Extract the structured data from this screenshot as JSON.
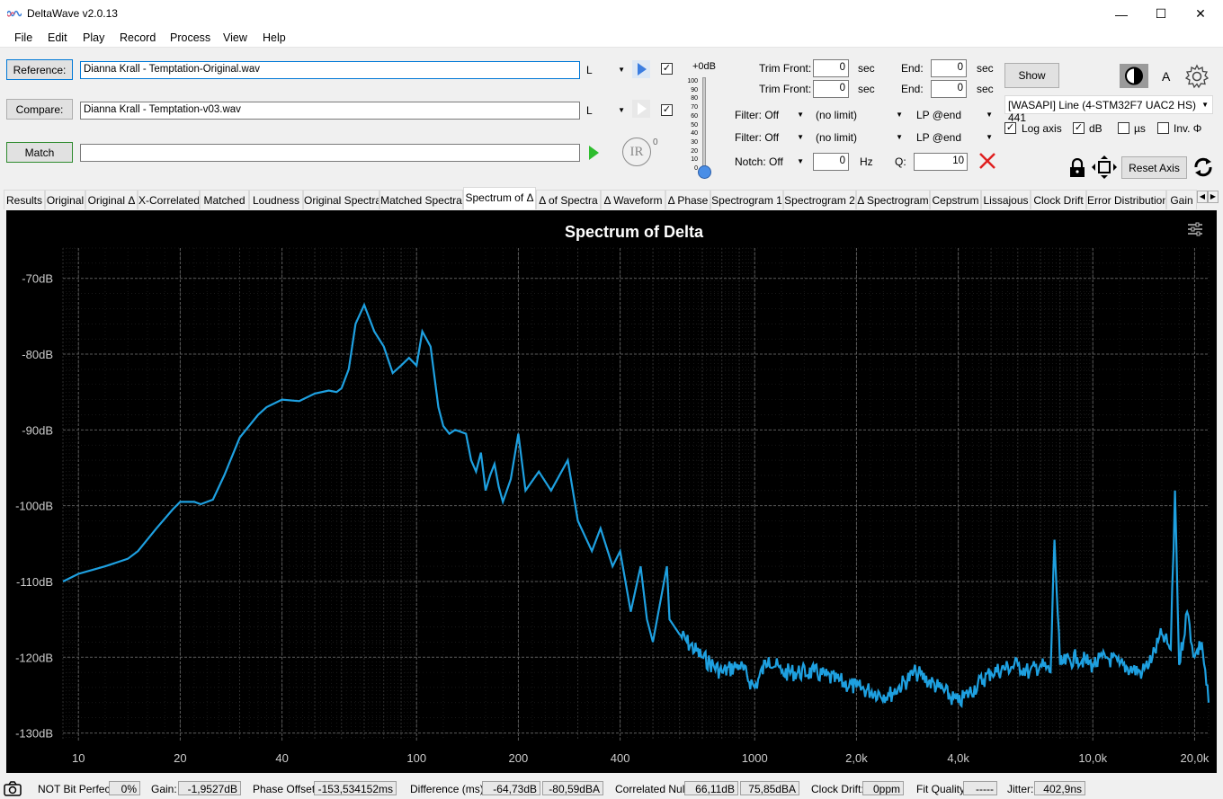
{
  "window": {
    "title": "DeltaWave v2.0.13",
    "minimize": "—",
    "maximize": "☐",
    "close": "✕"
  },
  "menu": [
    "File",
    "Edit",
    "Play",
    "Record",
    "Process",
    "View",
    "Help"
  ],
  "files": {
    "reference_label": "Reference:",
    "reference_file": "Dianna Krall - Temptation-Original.wav",
    "reference_channel": "L",
    "compare_label": "Compare:",
    "compare_file": "Dianna Krall - Temptation-v03.wav",
    "compare_channel": "L",
    "match_label": "Match",
    "match_value": ""
  },
  "ir": {
    "label": "IR",
    "superscript": "0"
  },
  "volume": {
    "label": "+0dB",
    "ticks": [
      "100",
      "90",
      "80",
      "70",
      "60",
      "50",
      "40",
      "30",
      "20",
      "10",
      "0"
    ],
    "level": 0
  },
  "trim": {
    "front_label": "Trim Front:",
    "front1": "0",
    "front2": "0",
    "unit": "sec",
    "end_label": "End:",
    "end1": "0",
    "end2": "0"
  },
  "filters": {
    "filter1": "Filter: Off",
    "filter2": "Filter: Off",
    "limit1": "(no limit)",
    "limit2": "(no limit)",
    "lp1": "LP @end",
    "lp2": "LP @end",
    "notch": "Notch: Off",
    "notch_value": "0",
    "hz": "Hz",
    "q_label": "Q:",
    "q_value": "10"
  },
  "right_panel": {
    "show_label": "Show",
    "a_label": "A",
    "device": "[WASAPI] Line (4-STM32F7 UAC2 HS) 441",
    "log_axis_label": "Log axis",
    "log_axis": true,
    "db_label": "dB",
    "db": true,
    "us_label": "µs",
    "us": false,
    "inv_label": "Inv. Φ",
    "inv": false,
    "reset_axis_label": "Reset Axis"
  },
  "tabs": [
    "Results",
    "Original",
    "Original Δ",
    "X-Correlated",
    "Matched",
    "Loudness",
    "Original Spectra",
    "Matched Spectra",
    "Spectrum of Δ",
    "Δ of Spectra",
    "Δ Waveform",
    "Δ Phase",
    "Spectrogram 1",
    "Spectrogram 2",
    "Δ Spectrogram",
    "Cepstrum",
    "Lissajous",
    "Clock Drift",
    "Error Distribution",
    "Gain"
  ],
  "active_tab": "Spectrum of Δ",
  "chart_data": {
    "type": "line",
    "title": "Spectrum of Delta",
    "xscale": "log",
    "xlim": [
      9,
      22000
    ],
    "ylim": [
      -131,
      -66
    ],
    "xticks": [
      10,
      20,
      40,
      100,
      200,
      400,
      1000,
      2000,
      4000,
      10000,
      20000
    ],
    "xtick_labels": [
      "10",
      "20",
      "40",
      "100",
      "200",
      "400",
      "1000",
      "2,0k",
      "4,0k",
      "10,0k",
      "20,0k"
    ],
    "yticks": [
      -70,
      -80,
      -90,
      -100,
      -110,
      -120,
      -130
    ],
    "ytick_labels": [
      "-70dB",
      "-80dB",
      "-90dB",
      "-100dB",
      "-110dB",
      "-120dB",
      "-130dB"
    ],
    "grid": true,
    "line_color": "#1ea0e0",
    "series": [
      {
        "x": [
          9,
          10,
          12,
          14,
          15,
          17,
          19,
          20,
          22,
          23,
          25,
          27,
          30,
          34,
          36,
          40,
          45,
          50,
          55,
          58,
          60,
          63,
          66,
          70,
          75,
          80,
          85,
          90,
          95,
          100,
          104,
          110,
          116,
          120,
          125,
          130,
          140,
          145,
          150,
          155,
          160,
          165,
          170,
          175,
          180,
          190,
          200,
          210,
          230,
          250,
          280,
          300,
          330,
          350,
          380,
          400,
          430,
          460,
          480,
          500,
          550,
          560,
          600,
          700,
          800,
          900,
          1000,
          1100,
          1200,
          1500,
          2000,
          2500,
          3000,
          3500,
          4000,
          5000,
          6000,
          6500,
          7000,
          7500,
          7700,
          8000,
          9000,
          10000,
          11000,
          12000,
          14000,
          15000,
          16000,
          17000,
          17500,
          18000,
          19000,
          20000,
          21000,
          22000
        ],
        "y": [
          -110,
          -109,
          -108,
          -107,
          -106,
          -103,
          -100.5,
          -99.5,
          -99.5,
          -99.8,
          -99.2,
          -96,
          -91,
          -88,
          -87,
          -86,
          -86.2,
          -85.2,
          -84.8,
          -85,
          -84.5,
          -82,
          -76,
          -73.5,
          -77,
          -79,
          -82.5,
          -81.5,
          -80.5,
          -81.5,
          -77,
          -79,
          -87,
          -89.5,
          -90.5,
          -90,
          -90.5,
          -94,
          -95.5,
          -93,
          -98,
          -96,
          -94.5,
          -97.5,
          -99.5,
          -96.5,
          -90.5,
          -98,
          -95.5,
          -98,
          -94,
          -102,
          -106,
          -103,
          -108,
          -106,
          -114,
          -108,
          -115,
          -118,
          -108,
          -115,
          -117,
          -120,
          -122,
          -121,
          -124,
          -120,
          -122,
          -122,
          -124,
          -125,
          -122,
          -124,
          -126,
          -122,
          -121,
          -122,
          -121,
          -122,
          -104.5,
          -121,
          -120,
          -121,
          -120,
          -121,
          -122,
          -120,
          -117,
          -119,
          -98,
          -121,
          -114,
          -120,
          -118,
          -126
        ],
        "color": "#1ea0e0"
      }
    ]
  },
  "status": {
    "bit_perfect": "NOT Bit Perfect",
    "bit_perfect_pct": "0%",
    "gain_label": "Gain:",
    "gain": "-1,9527dB",
    "phase_label": "Phase Offset:",
    "phase": "-153,534152ms",
    "diff_label": "Difference (ms):",
    "diff1": "-64,73dB",
    "diff2": "-80,59dBA",
    "null_label": "Correlated Null:",
    "null1": "66,11dB",
    "null2": "75,85dBA",
    "drift_label": "Clock Drift:",
    "drift": "0ppm",
    "fit_label": "Fit Quality:",
    "fit": "-----",
    "jitter_label": "Jitter:",
    "jitter": "402,9ns"
  }
}
